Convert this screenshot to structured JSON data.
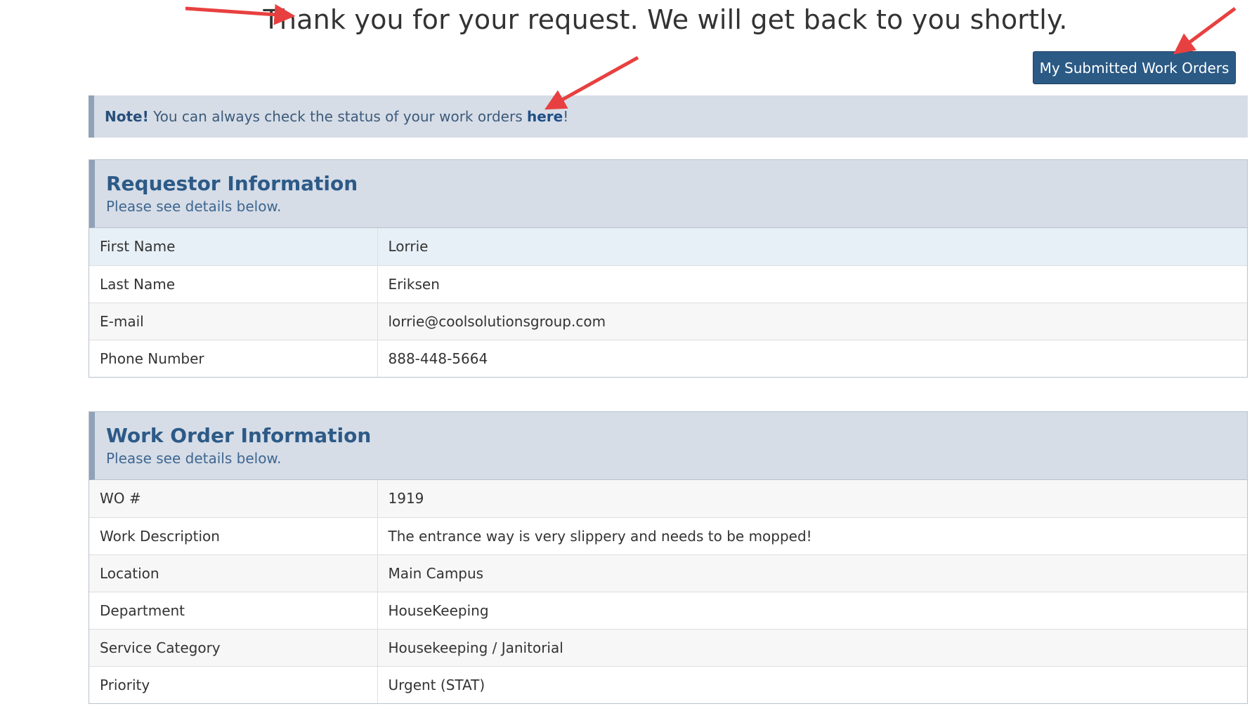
{
  "headline": "Thank you for your request. We will get back to you shortly.",
  "submitted_button": "My Submitted Work Orders",
  "note": {
    "strong": "Note!",
    "text": " You can always check the status of your work orders ",
    "link": "here",
    "suffix": "!"
  },
  "requestor": {
    "title": "Requestor Information",
    "subtitle": "Please see details below.",
    "rows": [
      {
        "label": "First Name",
        "value": "Lorrie"
      },
      {
        "label": "Last Name",
        "value": "Eriksen"
      },
      {
        "label": "E-mail",
        "value": "lorrie@coolsolutionsgroup.com"
      },
      {
        "label": "Phone Number",
        "value": "888-448-5664"
      }
    ]
  },
  "work_order": {
    "title": "Work Order Information",
    "subtitle": "Please see details below.",
    "rows": [
      {
        "label": "WO #",
        "value": "1919"
      },
      {
        "label": "Work Description",
        "value": "The entrance way is very slippery and needs to be mopped!"
      },
      {
        "label": "Location",
        "value": "Main Campus"
      },
      {
        "label": "Department",
        "value": "HouseKeeping"
      },
      {
        "label": "Service Category",
        "value": "Housekeeping / Janitorial"
      },
      {
        "label": "Priority",
        "value": "Urgent (STAT)"
      }
    ]
  },
  "colors": {
    "button": "#2b5a85",
    "panel_header": "#d6dde7",
    "title": "#2d5a87",
    "arrow": "#e84040"
  },
  "icons": [
    "annotation-arrow"
  ]
}
